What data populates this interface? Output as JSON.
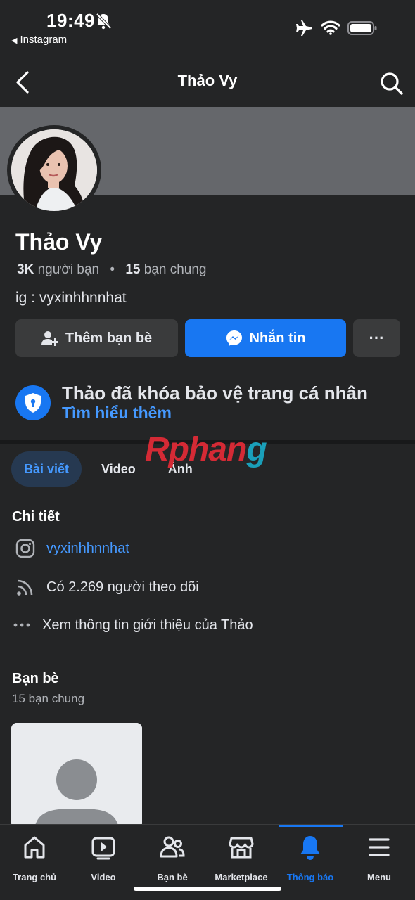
{
  "status_bar": {
    "time": "19:49",
    "back_app": "Instagram"
  },
  "navbar": {
    "title": "Thảo Vy"
  },
  "profile": {
    "name": "Thảo Vy",
    "friends_count": "3K",
    "friends_label": "người bạn",
    "mutual_count": "15",
    "mutual_label": "bạn chung",
    "bio": "ig : vyxinhhnnhat"
  },
  "actions": {
    "add_friend": "Thêm bạn bè",
    "message": "Nhắn tin",
    "more": "···"
  },
  "lock_notice": {
    "text": "Thảo đã khóa bảo vệ trang cá nhân",
    "learn_more": "Tìm hiểu thêm"
  },
  "watermark": {
    "part1": "Rphan",
    "part2": "g"
  },
  "tabs": [
    {
      "label": "Bài viết",
      "active": true
    },
    {
      "label": "Video",
      "active": false
    },
    {
      "label": "Ảnh",
      "active": false
    }
  ],
  "details": {
    "title": "Chi tiết",
    "instagram": "vyxinhhnnhat",
    "followers": "Có 2.269 người theo dõi",
    "see_about": "Xem thông tin giới thiệu của Thảo"
  },
  "friends": {
    "title": "Bạn bè",
    "subtitle": "15 bạn chung"
  },
  "bottom_nav": [
    {
      "label": "Trang chủ",
      "icon": "home-icon",
      "active": false
    },
    {
      "label": "Video",
      "icon": "video-icon",
      "active": false
    },
    {
      "label": "Bạn bè",
      "icon": "friends-icon",
      "active": false
    },
    {
      "label": "Marketplace",
      "icon": "marketplace-icon",
      "active": false
    },
    {
      "label": "Thông báo",
      "icon": "bell-icon",
      "active": true
    },
    {
      "label": "Menu",
      "icon": "menu-icon",
      "active": false
    }
  ],
  "colors": {
    "accent": "#1877f2",
    "link": "#4599ff",
    "background": "#242526"
  }
}
